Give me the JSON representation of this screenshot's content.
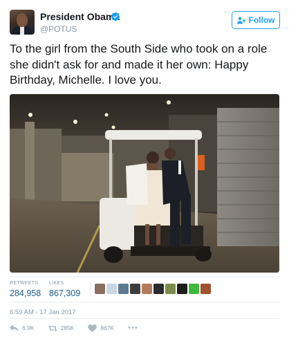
{
  "tweet": {
    "author_name": "President Obama",
    "author_handle": "@POTUS",
    "verified": true,
    "follow_label": "Follow",
    "text": "To the girl from the South Side who took on a role she didn't ask for and made it her own: Happy Birthday, Michelle. I love you.",
    "timestamp": "6:59 AM - 17 Jan 2017"
  },
  "stats": {
    "retweets_label": "RETWEETS",
    "retweets_value": "284,958",
    "likes_label": "LIKES",
    "likes_value": "867,309",
    "liker_avatar_colors": [
      "#8a6f5e",
      "#c8d6e2",
      "#5b7a8f",
      "#3d3d3d",
      "#b57a5a",
      "#2b2b2b",
      "#7d8c4a",
      "#1c1c1c",
      "#3fb83f",
      "#a0522d"
    ]
  },
  "actions": {
    "reply_count": "6.9K",
    "retweet_count": "285K",
    "like_count": "867K",
    "more_label": "•••"
  },
  "colors": {
    "accent": "#1da1f2",
    "muted": "#8899a6",
    "stat_value": "#1d5b8c"
  }
}
